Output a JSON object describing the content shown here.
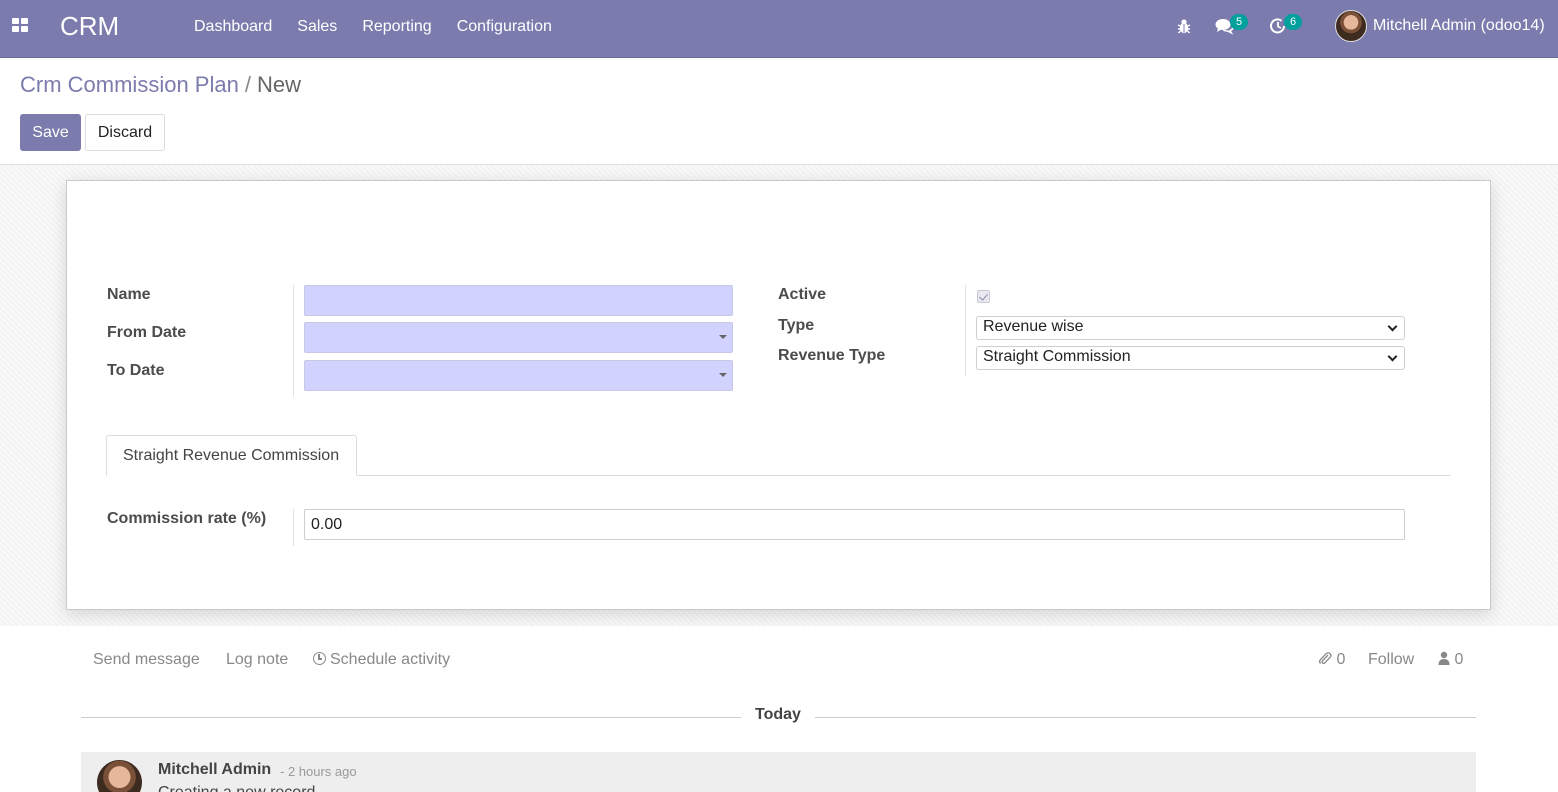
{
  "navbar": {
    "app_name": "CRM",
    "menu": [
      "Dashboard",
      "Sales",
      "Reporting",
      "Configuration"
    ],
    "messages_count": "5",
    "activities_count": "6",
    "user_name": "Mitchell Admin (odoo14)"
  },
  "breadcrumb": {
    "parent": "Crm Commission Plan",
    "separator": "/",
    "current": "New"
  },
  "buttons": {
    "save": "Save",
    "discard": "Discard"
  },
  "form": {
    "name_label": "Name",
    "name_value": "",
    "from_date_label": "From Date",
    "from_date_value": "",
    "to_date_label": "To Date",
    "to_date_value": "",
    "active_label": "Active",
    "active_checked": true,
    "type_label": "Type",
    "type_value": "Revenue wise",
    "revenue_type_label": "Revenue Type",
    "revenue_type_value": "Straight Commission"
  },
  "tabs": [
    {
      "label": "Straight Revenue Commission",
      "active": true
    }
  ],
  "tab_content": {
    "commission_rate_label": "Commission rate (%)",
    "commission_rate_value": "0.00"
  },
  "chatter": {
    "send_message": "Send message",
    "log_note": "Log note",
    "schedule_activity": "Schedule activity",
    "attachments_count": "0",
    "follow": "Follow",
    "followers_count": "0",
    "date_separator": "Today",
    "message": {
      "author": "Mitchell Admin",
      "date": "- 2 hours ago",
      "body": "Creating a new record..."
    }
  },
  "colors": {
    "brand": "#7c7bad",
    "badge": "#00a09d",
    "required_field": "#d2d2ff"
  }
}
